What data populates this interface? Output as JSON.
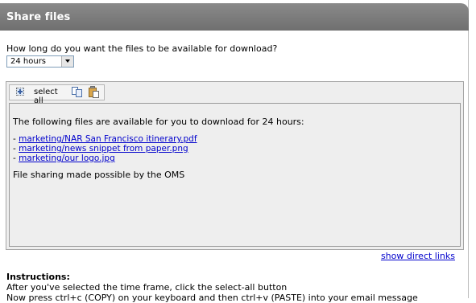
{
  "header": {
    "title": "Share files"
  },
  "form": {
    "question": "How long do you want the files to be available for download?",
    "duration_selected": "24 hours"
  },
  "toolbar": {
    "select_all_label": "select all",
    "icons": [
      "select-all-icon",
      "copy-icon",
      "paste-icon"
    ]
  },
  "message": {
    "intro": "The following files are available for you to download for 24 hours:",
    "files": [
      {
        "prefix": "-",
        "link": "marketing/NAR San Francisco itinerary.pdf"
      },
      {
        "prefix": "-",
        "link": "marketing/news snippet from paper.png"
      },
      {
        "prefix": "-",
        "link": "marketing/our logo.jpg"
      }
    ],
    "footer": "File sharing made possible by the OMS"
  },
  "links": {
    "show_direct": "show direct links"
  },
  "instructions": {
    "title": "Instructions:",
    "lines": [
      "After you've selected the time frame, click the select-all button",
      "Now press ctrl+c (COPY) on your keyboard and then ctrl+v (PASTE) into your email message"
    ]
  },
  "colors": {
    "header_bg": "#7c7c7c",
    "editor_bg": "#eeeeee",
    "link": "#0000cc"
  }
}
